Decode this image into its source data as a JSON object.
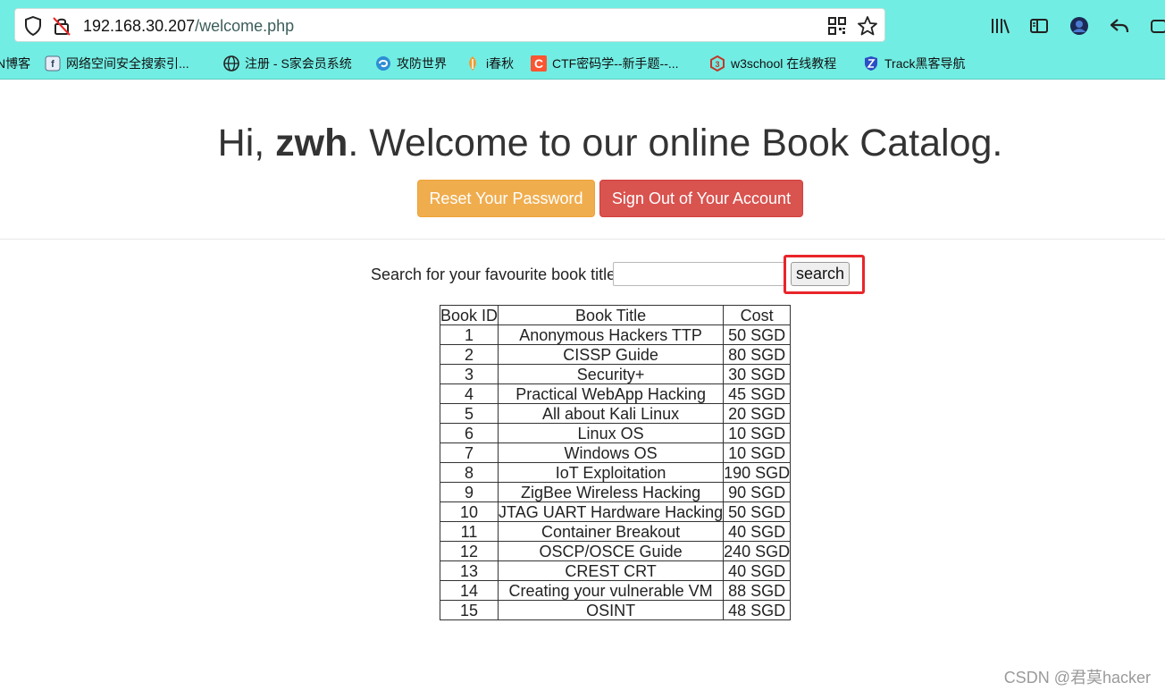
{
  "browser": {
    "url_host": "192.168.30.207",
    "url_path": "/welcome.php",
    "bookmarks": [
      {
        "label": "N博客",
        "icon": "csdn-icon"
      },
      {
        "label": "网络空间安全搜索引...",
        "icon": "fofa-icon"
      },
      {
        "label": "注册 - S家会员系统",
        "icon": "globe-icon"
      },
      {
        "label": "攻防世界",
        "icon": "adworld-icon"
      },
      {
        "label": "i春秋",
        "icon": "ichunqiu-icon"
      },
      {
        "label": "CTF密码学--新手题--...",
        "icon": "csdn-c-icon"
      },
      {
        "label": "w3school 在线教程",
        "icon": "w3school-icon"
      },
      {
        "label": "Track黑客导航",
        "icon": "shield-icon"
      }
    ]
  },
  "page": {
    "greeting_prefix": "Hi, ",
    "username": "zwh",
    "greeting_suffix": ". Welcome to our online Book Catalog.",
    "reset_button": "Reset Your Password",
    "signout_button": "Sign Out of Your Account",
    "search_label": "Search for your favourite book title",
    "search_value": "",
    "search_button": "search"
  },
  "table": {
    "headers": [
      "Book ID",
      "Book Title",
      "Cost"
    ],
    "rows": [
      [
        "1",
        "Anonymous Hackers TTP",
        "50 SGD"
      ],
      [
        "2",
        "CISSP Guide",
        "80 SGD"
      ],
      [
        "3",
        "Security+",
        "30 SGD"
      ],
      [
        "4",
        "Practical WebApp Hacking",
        "45 SGD"
      ],
      [
        "5",
        "All about Kali Linux",
        "20 SGD"
      ],
      [
        "6",
        "Linux OS",
        "10 SGD"
      ],
      [
        "7",
        "Windows OS",
        "10 SGD"
      ],
      [
        "8",
        "IoT Exploitation",
        "190 SGD"
      ],
      [
        "9",
        "ZigBee Wireless Hacking",
        "90 SGD"
      ],
      [
        "10",
        "JTAG UART Hardware Hacking",
        "50 SGD"
      ],
      [
        "11",
        "Container Breakout",
        "40 SGD"
      ],
      [
        "12",
        "OSCP/OSCE Guide",
        "240 SGD"
      ],
      [
        "13",
        "CREST CRT",
        "40 SGD"
      ],
      [
        "14",
        "Creating your vulnerable VM",
        "88 SGD"
      ],
      [
        "15",
        "OSINT",
        "48 SGD"
      ]
    ]
  },
  "watermark": "CSDN @君莫hacker",
  "colors": {
    "chrome_bg": "#72ede3",
    "warning": "#f0ad4e",
    "danger": "#d9534f",
    "highlight": "#e8252a"
  }
}
